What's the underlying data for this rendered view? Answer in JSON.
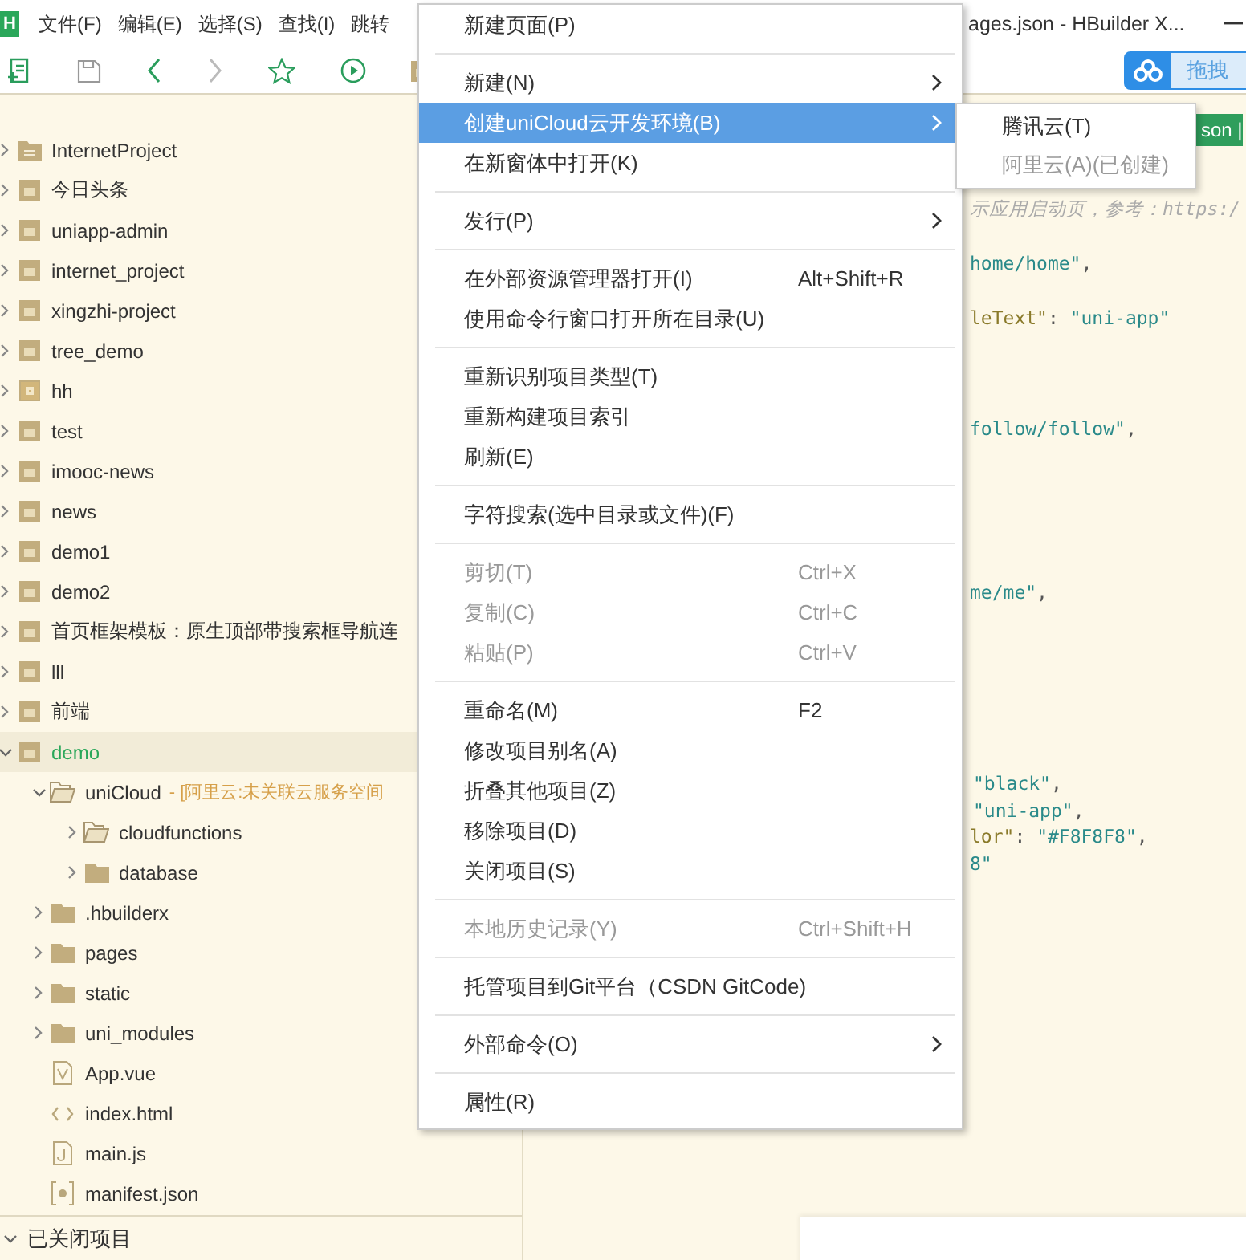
{
  "menubar": {
    "logo": "H",
    "items": [
      "文件(F)",
      "编辑(E)",
      "选择(S)",
      "查找(I)",
      "跳转"
    ]
  },
  "title": "ages.json - HBuilder X...",
  "upload_button": "拖拽",
  "editor_tab": "son |",
  "code_lines": [
    {
      "parts": [
        {
          "kind": "comment",
          "text": "示应用启动页，参考：https:/"
        }
      ]
    },
    {
      "parts": [
        {
          "kind": "string",
          "text": "home/home\""
        },
        {
          "kind": "punct",
          "text": ","
        }
      ]
    },
    {
      "parts": [
        {
          "kind": "key",
          "text": "leText\""
        },
        {
          "kind": "punct",
          "text": ": "
        },
        {
          "kind": "string",
          "text": "\"uni-app\""
        }
      ]
    },
    {
      "parts": [
        {
          "kind": "string",
          "text": "follow/follow\""
        },
        {
          "kind": "punct",
          "text": ","
        }
      ]
    },
    {
      "parts": [
        {
          "kind": "string",
          "text": "me/me\""
        },
        {
          "kind": "punct",
          "text": ","
        }
      ]
    },
    {
      "parts": [
        {
          "kind": "string",
          "text": "\"black\""
        },
        {
          "kind": "punct",
          "text": ","
        }
      ]
    },
    {
      "parts": [
        {
          "kind": "string",
          "text": "\"uni-app\""
        },
        {
          "kind": "punct",
          "text": ","
        }
      ]
    },
    {
      "parts": [
        {
          "kind": "key",
          "text": "lor\""
        },
        {
          "kind": "punct",
          "text": ": "
        },
        {
          "kind": "string",
          "text": "\"#F8F8F8\""
        },
        {
          "kind": "punct",
          "text": ","
        }
      ]
    },
    {
      "parts": [
        {
          "kind": "string",
          "text": "8\""
        }
      ]
    }
  ],
  "tree": [
    {
      "label": "InternetProject",
      "kind": "plain-folder",
      "expanded": false,
      "selected": false
    },
    {
      "label": "今日头条",
      "kind": "uni",
      "expanded": false,
      "selected": false
    },
    {
      "label": "uniapp-admin",
      "kind": "uni",
      "expanded": false,
      "selected": false
    },
    {
      "label": "internet_project",
      "kind": "uni",
      "expanded": false,
      "selected": false
    },
    {
      "label": "xingzhi-project",
      "kind": "uni",
      "expanded": false,
      "selected": false
    },
    {
      "label": "tree_demo",
      "kind": "uni",
      "expanded": false,
      "selected": false
    },
    {
      "label": "hh",
      "kind": "plus",
      "expanded": false,
      "selected": false
    },
    {
      "label": "test",
      "kind": "uni",
      "expanded": false,
      "selected": false
    },
    {
      "label": "imooc-news",
      "kind": "uni",
      "expanded": false,
      "selected": false
    },
    {
      "label": "news",
      "kind": "uni",
      "expanded": false,
      "selected": false
    },
    {
      "label": "demo1",
      "kind": "uni",
      "expanded": false,
      "selected": false
    },
    {
      "label": "demo2",
      "kind": "uni",
      "expanded": false,
      "selected": false
    },
    {
      "label": "首页框架模板：原生顶部带搜索框导航连",
      "kind": "uni",
      "expanded": false,
      "selected": false
    },
    {
      "label": "lll",
      "kind": "uni",
      "expanded": false,
      "selected": false
    },
    {
      "label": "前端",
      "kind": "uni",
      "expanded": false,
      "selected": false
    },
    {
      "label": "demo",
      "kind": "uni",
      "expanded": true,
      "selected": true,
      "children": [
        {
          "label": "uniCloud",
          "note": "- [阿里云:未关联云服务空间",
          "kind": "open-folder",
          "expanded": true,
          "selected": false,
          "children": [
            {
              "label": "cloudfunctions",
              "kind": "open-folder",
              "expanded": false,
              "selected": false
            },
            {
              "label": "database",
              "kind": "folder",
              "expanded": false,
              "selected": false
            }
          ]
        },
        {
          "label": ".hbuilderx",
          "kind": "folder",
          "expanded": false,
          "selected": false
        },
        {
          "label": "pages",
          "kind": "folder",
          "expanded": false,
          "selected": false
        },
        {
          "label": "static",
          "kind": "folder",
          "expanded": false,
          "selected": false
        },
        {
          "label": "uni_modules",
          "kind": "folder",
          "expanded": false,
          "selected": false
        },
        {
          "label": "App.vue",
          "kind": "vue",
          "selected": false
        },
        {
          "label": "index.html",
          "kind": "html",
          "selected": false
        },
        {
          "label": "main.js",
          "kind": "js",
          "selected": false
        },
        {
          "label": "manifest.json",
          "kind": "json",
          "selected": false
        }
      ]
    }
  ],
  "closed_projects": {
    "label": "已关闭项目",
    "expanded": true
  },
  "context_menu": [
    {
      "kind": "item",
      "label": "新建页面(P)",
      "disabled": false,
      "selected": false,
      "submenu": false
    },
    {
      "kind": "separator"
    },
    {
      "kind": "item",
      "label": "新建(N)",
      "disabled": false,
      "selected": false,
      "submenu": true
    },
    {
      "kind": "item",
      "label": "创建uniCloud云开发环境(B)",
      "disabled": false,
      "selected": true,
      "submenu": true
    },
    {
      "kind": "item",
      "label": "在新窗体中打开(K)",
      "disabled": false,
      "selected": false,
      "submenu": false
    },
    {
      "kind": "separator"
    },
    {
      "kind": "item",
      "label": "发行(P)",
      "disabled": false,
      "selected": false,
      "submenu": true
    },
    {
      "kind": "separator"
    },
    {
      "kind": "item",
      "label": "在外部资源管理器打开(I)",
      "shortcut": "Alt+Shift+R",
      "disabled": false,
      "selected": false,
      "submenu": false
    },
    {
      "kind": "item",
      "label": "使用命令行窗口打开所在目录(U)",
      "disabled": false,
      "selected": false,
      "submenu": false
    },
    {
      "kind": "separator"
    },
    {
      "kind": "item",
      "label": "重新识别项目类型(T)",
      "disabled": false,
      "selected": false,
      "submenu": false
    },
    {
      "kind": "item",
      "label": "重新构建项目索引",
      "disabled": false,
      "selected": false,
      "submenu": false
    },
    {
      "kind": "item",
      "label": "刷新(E)",
      "disabled": false,
      "selected": false,
      "submenu": false
    },
    {
      "kind": "separator"
    },
    {
      "kind": "item",
      "label": "字符搜索(选中目录或文件)(F)",
      "disabled": false,
      "selected": false,
      "submenu": false
    },
    {
      "kind": "separator"
    },
    {
      "kind": "item",
      "label": "剪切(T)",
      "shortcut": "Ctrl+X",
      "disabled": true,
      "selected": false,
      "submenu": false
    },
    {
      "kind": "item",
      "label": "复制(C)",
      "shortcut": "Ctrl+C",
      "disabled": true,
      "selected": false,
      "submenu": false
    },
    {
      "kind": "item",
      "label": "粘贴(P)",
      "shortcut": "Ctrl+V",
      "disabled": true,
      "selected": false,
      "submenu": false
    },
    {
      "kind": "separator"
    },
    {
      "kind": "item",
      "label": "重命名(M)",
      "shortcut": "F2",
      "disabled": false,
      "selected": false,
      "submenu": false
    },
    {
      "kind": "item",
      "label": "修改项目别名(A)",
      "disabled": false,
      "selected": false,
      "submenu": false
    },
    {
      "kind": "item",
      "label": "折叠其他项目(Z)",
      "disabled": false,
      "selected": false,
      "submenu": false
    },
    {
      "kind": "item",
      "label": "移除项目(D)",
      "disabled": false,
      "selected": false,
      "submenu": false
    },
    {
      "kind": "item",
      "label": "关闭项目(S)",
      "disabled": false,
      "selected": false,
      "submenu": false
    },
    {
      "kind": "separator"
    },
    {
      "kind": "item",
      "label": "本地历史记录(Y)",
      "shortcut": "Ctrl+Shift+H",
      "disabled": true,
      "selected": false,
      "submenu": false
    },
    {
      "kind": "separator"
    },
    {
      "kind": "item",
      "label": "托管项目到Git平台（CSDN GitCode)",
      "disabled": false,
      "selected": false,
      "submenu": false
    },
    {
      "kind": "separator"
    },
    {
      "kind": "item",
      "label": "外部命令(O)",
      "disabled": false,
      "selected": false,
      "submenu": true
    },
    {
      "kind": "separator"
    },
    {
      "kind": "item",
      "label": "属性(R)",
      "disabled": false,
      "selected": false,
      "submenu": false
    }
  ],
  "submenu": [
    {
      "label": "腾讯云(T)",
      "disabled": false
    },
    {
      "label": "阿里云(A)(已创建)",
      "disabled": true
    }
  ]
}
